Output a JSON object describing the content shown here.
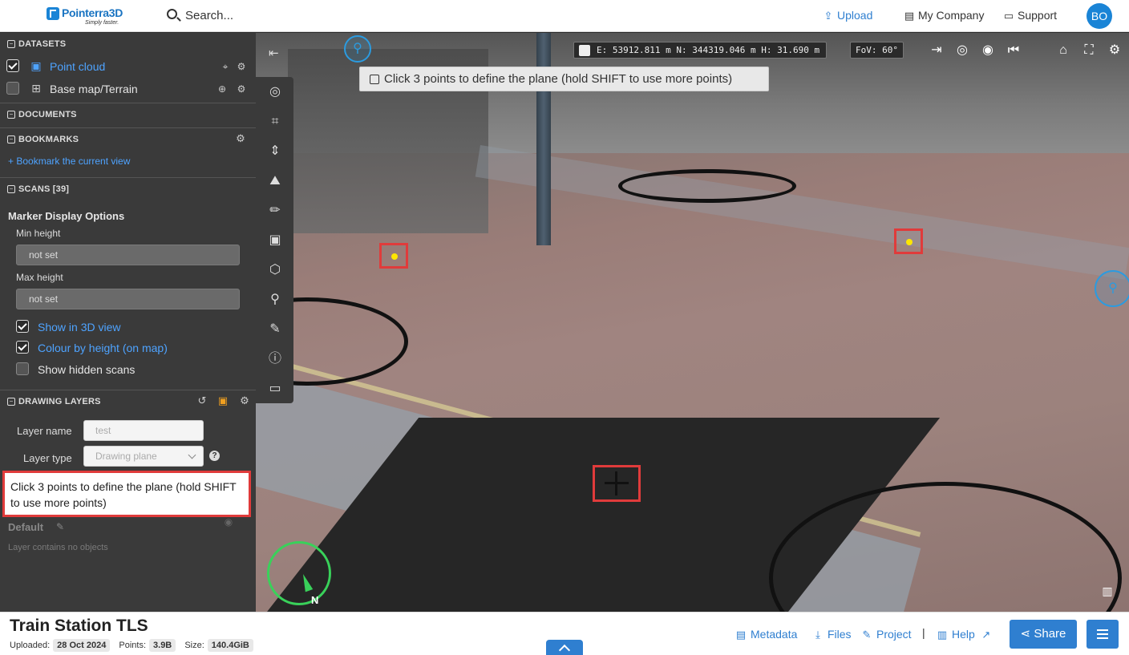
{
  "header": {
    "logo_name": "Pointerra3D",
    "logo_tagline": "Simply faster.",
    "search_placeholder": "Search...",
    "upload": "Upload",
    "company": "My Company",
    "support": "Support",
    "avatar_initials": "BO"
  },
  "panel": {
    "datasets": {
      "title": "DATASETS",
      "items": [
        {
          "label": "Point cloud",
          "checked": true
        },
        {
          "label": "Base map/Terrain",
          "checked": false
        }
      ]
    },
    "documents": {
      "title": "DOCUMENTS"
    },
    "bookmarks": {
      "title": "BOOKMARKS",
      "add_link": "+ Bookmark the current view"
    },
    "scans": {
      "title": "SCANS [39]",
      "marker_title": "Marker Display Options",
      "min_height_label": "Min height",
      "min_height_value": "not set",
      "max_height_label": "Max height",
      "max_height_value": "not set",
      "show_3d": "Show in 3D view",
      "colour_by_height": "Colour by height (on map)",
      "show_hidden": "Show hidden scans"
    },
    "drawing": {
      "title": "DRAWING LAYERS",
      "layer_name_label": "Layer name",
      "layer_name_placeholder": "test",
      "layer_type_label": "Layer type",
      "layer_type_value": "Drawing plane",
      "hint": "Click 3 points to define the plane (hold SHIFT to use more points)",
      "default_layer": "Default",
      "empty_text": "Layer contains no objects"
    }
  },
  "viewport": {
    "coordinates": "E: 53912.811 m N: 344319.046 m H: 31.690 m",
    "fov": "FoV: 60°",
    "banner": "Click 3 points to define the plane (hold SHIFT to use more points)",
    "compass_north": "N"
  },
  "footer": {
    "title": "Train Station TLS",
    "uploaded_label": "Uploaded:",
    "uploaded_value": "28 Oct 2024",
    "points_label": "Points:",
    "points_value": "3.9B",
    "size_label": "Size:",
    "size_value": "140.4GiB",
    "metadata": "Metadata",
    "files": "Files",
    "project": "Project",
    "separator": "|",
    "help": "Help",
    "share": "Share"
  },
  "colors": {
    "accent": "#2f7fd0",
    "highlight": "#e03b3b",
    "compass": "#39d15a"
  }
}
